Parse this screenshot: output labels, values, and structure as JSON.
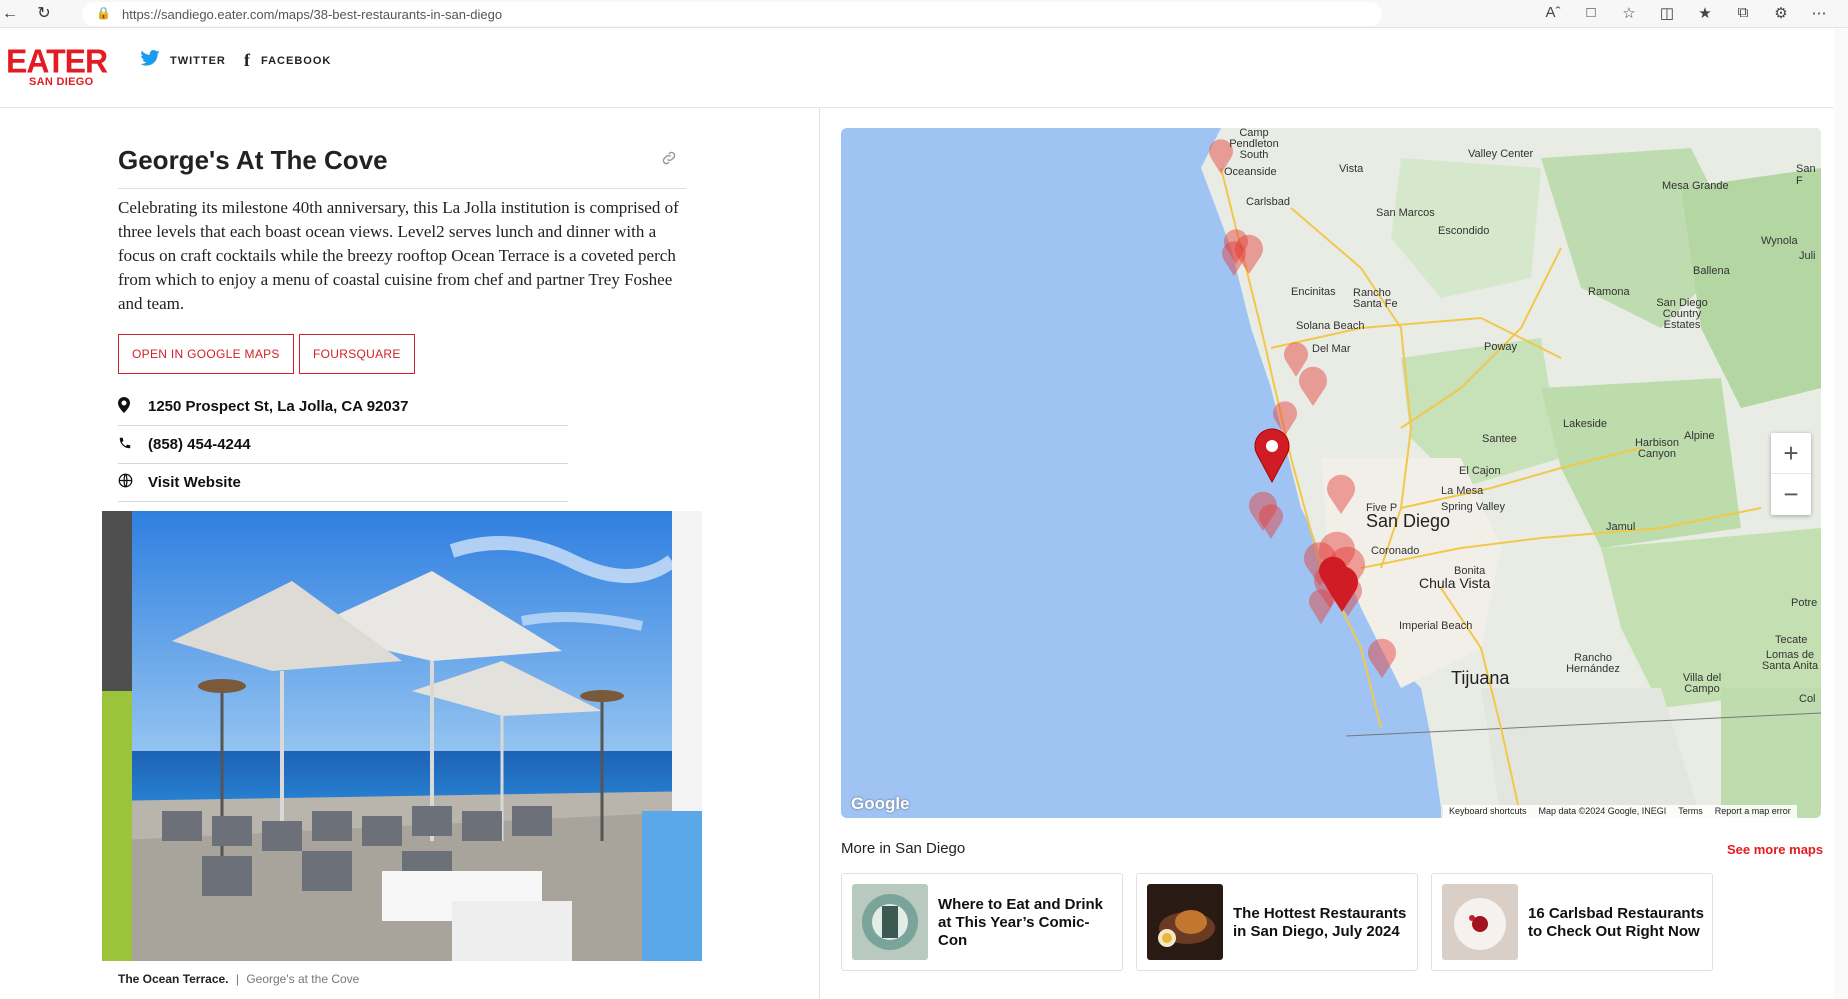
{
  "browser": {
    "url": "https://sandiego.eater.com/maps/38-best-restaurants-in-san-diego",
    "back_icon": "back-arrow-icon",
    "reload_icon": "reload-icon"
  },
  "header": {
    "logo_text": "EATER",
    "logo_city": "SAN DIEGO",
    "social": [
      {
        "label": "TWITTER",
        "icon": "twitter-icon"
      },
      {
        "label": "FACEBOOK",
        "icon": "facebook-icon"
      }
    ]
  },
  "place": {
    "title": "George's At The Cove",
    "description": "Celebrating its milestone 40th anniversary, this La Jolla institution is comprised of three levels that each boast ocean views. Level2 serves lunch and dinner with a focus on craft cocktails while the breezy rooftop Ocean Terrace is a coveted perch from which to enjoy a menu of coastal cuisine from chef and partner Trey Foshee and team.",
    "buttons": {
      "google_maps": "OPEN IN GOOGLE MAPS",
      "foursquare": "FOURSQUARE"
    },
    "address": "1250 Prospect St, La Jolla, CA 92037",
    "phone": "(858) 454-4244",
    "website": "Visit Website",
    "caption": "The Ocean Terrace.",
    "caption_sep": "|",
    "caption_credit": "George's at the Cove"
  },
  "map": {
    "labels": {
      "camp_pendleton": "Camp Pendleton South",
      "oceanside": "Oceanside",
      "vista": "Vista",
      "valley_center": "Valley Center",
      "mesa_grande": "Mesa Grande",
      "carlsbad": "Carlsbad",
      "san_marcos": "San Marcos",
      "escondido": "Escondido",
      "wynola": "Wynola",
      "ballena": "Ballena",
      "encinitas": "Encinitas",
      "rancho_santa_fe": "Rancho Santa Fe",
      "ramona": "Ramona",
      "solana_beach": "Solana Beach",
      "sd_country_estates": "San Diego Country Estates",
      "del_mar": "Del Mar",
      "poway": "Poway",
      "lakeside": "Lakeside",
      "santee": "Santee",
      "harbison_canyon": "Harbison Canyon",
      "alpine": "Alpine",
      "el_cajon": "El Cajon",
      "la_mesa": "La Mesa",
      "spring_valley": "Spring Valley",
      "five_points": "Five P",
      "san_diego": "San Diego",
      "jamul": "Jamul",
      "coronado": "Coronado",
      "bonita": "Bonita",
      "chula_vista": "Chula Vista",
      "imperial_beach": "Imperial Beach",
      "tijuana": "Tijuana",
      "rancho_hernandez": "Rancho Hernández",
      "villa_del_campo": "Villa del Campo",
      "tecate": "Tecate",
      "lomas_de_santa_anita": "Lomas de Santa Anita",
      "potrero": "Potre",
      "col": "Col",
      "san_f": "San F",
      "juli": "Juli"
    },
    "google": "Google",
    "footer": [
      "Keyboard shortcuts",
      "Map data ©2024 Google, INEGI",
      "Terms",
      "Report a map error"
    ],
    "zoom_in": "+",
    "zoom_out": "−"
  },
  "more": {
    "title": "More in San Diego",
    "see_more": "See more maps",
    "cards": [
      {
        "title": "Where to Eat and Drink at This Year’s Comic-Con"
      },
      {
        "title": "The Hottest Restaurants in San Diego, July 2024"
      },
      {
        "title": "16 Carlsbad Restaurants to Check Out Right Now"
      }
    ]
  }
}
